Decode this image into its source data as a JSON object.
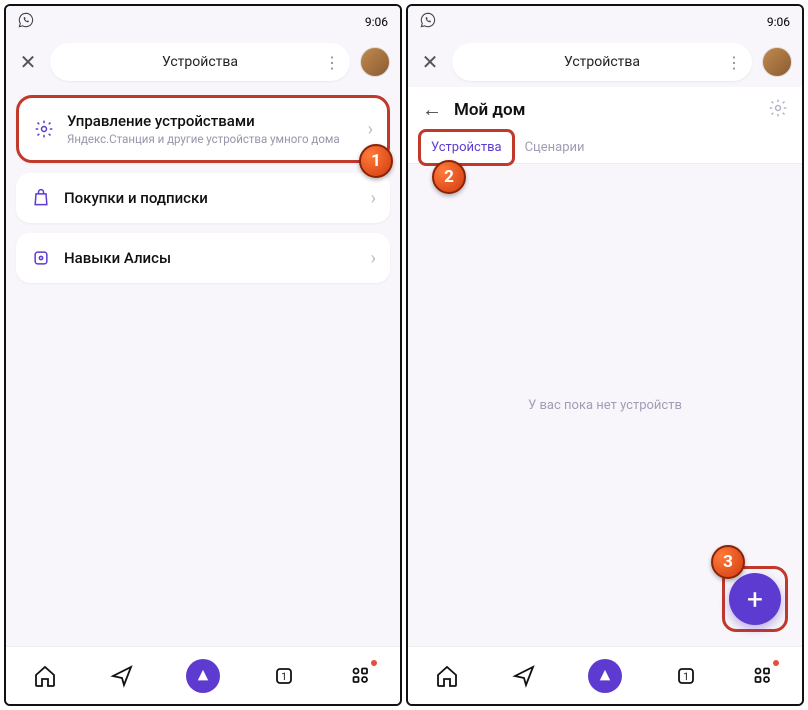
{
  "status": {
    "time": "9:06"
  },
  "header": {
    "title": "Устройства"
  },
  "cards": {
    "manage": {
      "title": "Управление устройствами",
      "sub": "Яндекс.Станция и другие устройства умного дома"
    },
    "purchases": {
      "title": "Покупки и подписки"
    },
    "skills": {
      "title": "Навыки Алисы"
    }
  },
  "steps": {
    "s1": "1",
    "s2": "2",
    "s3": "3"
  },
  "home": {
    "title": "Мой дом",
    "tab_devices": "Устройства",
    "tab_scenarios": "Сценарии",
    "empty": "У вас пока нет устройств"
  },
  "nav": {
    "tabs_count": "1"
  }
}
